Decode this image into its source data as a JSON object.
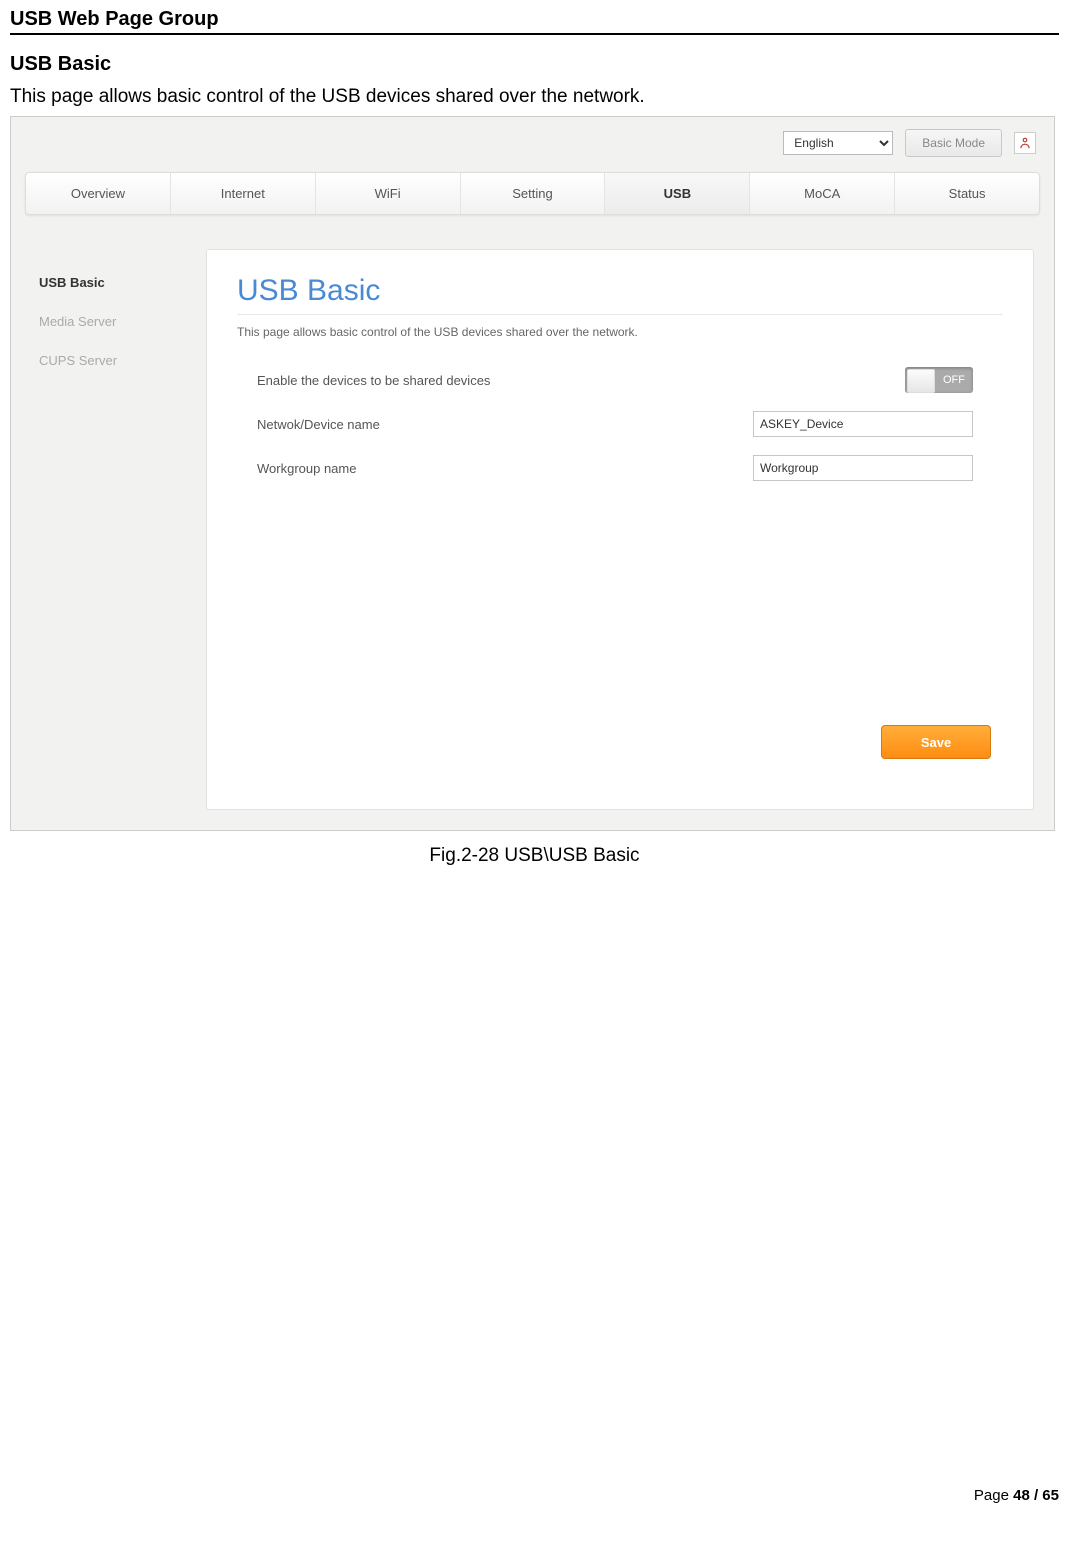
{
  "doc": {
    "header": "USB Web Page Group",
    "sub_header": "USB Basic",
    "intro": "This page allows basic control of the USB devices shared over the network.",
    "caption": "Fig.2-28 USB\\USB Basic",
    "footer_prefix": "Page ",
    "footer_page": "48 / 65"
  },
  "topbar": {
    "language": "English",
    "mode_button": "Basic Mode"
  },
  "tabs": [
    "Overview",
    "Internet",
    "WiFi",
    "Setting",
    "USB",
    "MoCA",
    "Status"
  ],
  "active_tab_index": 4,
  "sidebar": {
    "items": [
      "USB Basic",
      "Media Server",
      "CUPS Server"
    ],
    "active_index": 0
  },
  "panel": {
    "title": "USB Basic",
    "description": "This page allows basic control of the USB devices shared over the network.",
    "rows": {
      "enable_label": "Enable the devices to be shared devices",
      "toggle_state": "OFF",
      "device_label": "Netwok/Device name",
      "device_value": "ASKEY_Device",
      "workgroup_label": "Workgroup name",
      "workgroup_value": "Workgroup"
    },
    "save_label": "Save"
  }
}
